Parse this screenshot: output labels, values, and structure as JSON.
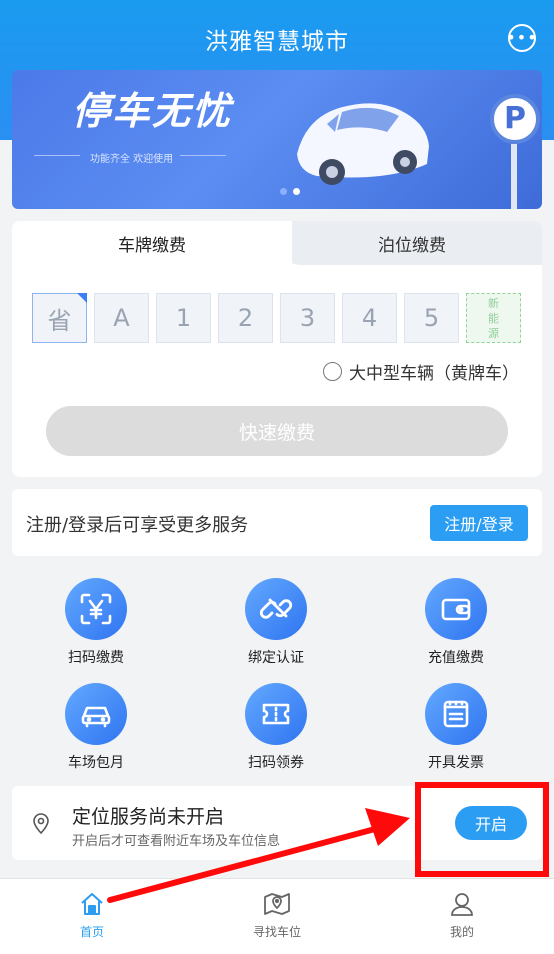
{
  "header": {
    "title": "洪雅智慧城市",
    "chat_icon": "chat-bubble-icon"
  },
  "banner": {
    "title": "停车无忧",
    "subtitle": "功能齐全 欢迎使用",
    "sign_letter": "P"
  },
  "payment": {
    "tabs": [
      {
        "label": "车牌缴费"
      },
      {
        "label": "泊位缴费"
      }
    ],
    "plate_slots": [
      "省",
      "A",
      "1",
      "2",
      "3",
      "4",
      "5"
    ],
    "new_energy": [
      "新",
      "能",
      "源"
    ],
    "yellow_plate_label": "大中型车辆（黄牌车）",
    "quick_pay_label": "快速缴费"
  },
  "login": {
    "prompt": "注册/登录后可享受更多服务",
    "button": "注册/登录"
  },
  "services": [
    {
      "label": "扫码缴费",
      "icon": "scan-yen-icon"
    },
    {
      "label": "绑定认证",
      "icon": "link-icon"
    },
    {
      "label": "充值缴费",
      "icon": "wallet-icon"
    },
    {
      "label": "车场包月",
      "icon": "car-icon"
    },
    {
      "label": "扫码领券",
      "icon": "ticket-icon"
    },
    {
      "label": "开具发票",
      "icon": "invoice-icon"
    }
  ],
  "location": {
    "title": "定位服务尚未开启",
    "subtitle": "开启后才可查看附近车场及车位信息",
    "button": "开启"
  },
  "tabbar": [
    {
      "label": "首页",
      "icon": "home-icon",
      "active": true
    },
    {
      "label": "寻找车位",
      "icon": "map-icon",
      "active": false
    },
    {
      "label": "我的",
      "icon": "user-icon",
      "active": false
    }
  ],
  "colors": {
    "primary": "#2b9ef3",
    "annotation": "#ff0a0a"
  }
}
